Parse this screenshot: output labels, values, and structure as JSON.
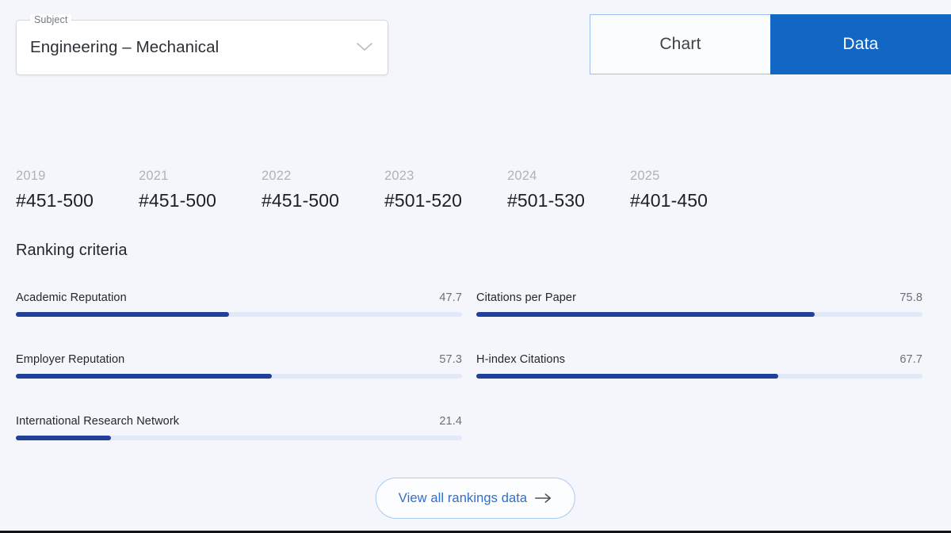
{
  "subject_select": {
    "legend": "Subject",
    "value": "Engineering – Mechanical",
    "chevron_icon": "chevron-down-icon"
  },
  "view_toggle": {
    "chart_label": "Chart",
    "data_label": "Data",
    "active": "Data"
  },
  "rankings_by_year": [
    {
      "year": "2019",
      "rank": "#451-500"
    },
    {
      "year": "2021",
      "rank": "#451-500"
    },
    {
      "year": "2022",
      "rank": "#451-500"
    },
    {
      "year": "2023",
      "rank": "#501-520"
    },
    {
      "year": "2024",
      "rank": "#501-530"
    },
    {
      "year": "2025",
      "rank": "#401-450"
    }
  ],
  "criteria_section": {
    "heading": "Ranking criteria",
    "left_column": [
      {
        "name": "Academic Reputation",
        "value": "47.7"
      },
      {
        "name": "Employer Reputation",
        "value": "57.3"
      },
      {
        "name": "International Research Network",
        "value": "21.4"
      }
    ],
    "right_column": [
      {
        "name": "Citations per Paper",
        "value": "75.8"
      },
      {
        "name": "H-index Citations",
        "value": "67.7"
      }
    ]
  },
  "footer_button": {
    "label": "View all rankings data",
    "arrow_icon": "arrow-right-icon"
  },
  "colors": {
    "background": "#f4f6fb",
    "accent_blue": "#1266c4",
    "bar_fill": "#21409a",
    "bar_track": "#e1e9f8",
    "link_blue": "#2f6fcb"
  },
  "chart_data": {
    "type": "bar",
    "title": "Ranking criteria",
    "orientation": "horizontal",
    "categories": [
      "Academic Reputation",
      "Employer Reputation",
      "International Research Network",
      "Citations per Paper",
      "H-index Citations"
    ],
    "values": [
      47.7,
      57.3,
      21.4,
      75.8,
      67.7
    ],
    "xlim": [
      0,
      100
    ],
    "xlabel": "",
    "ylabel": "",
    "grid": false,
    "legend": "none"
  }
}
